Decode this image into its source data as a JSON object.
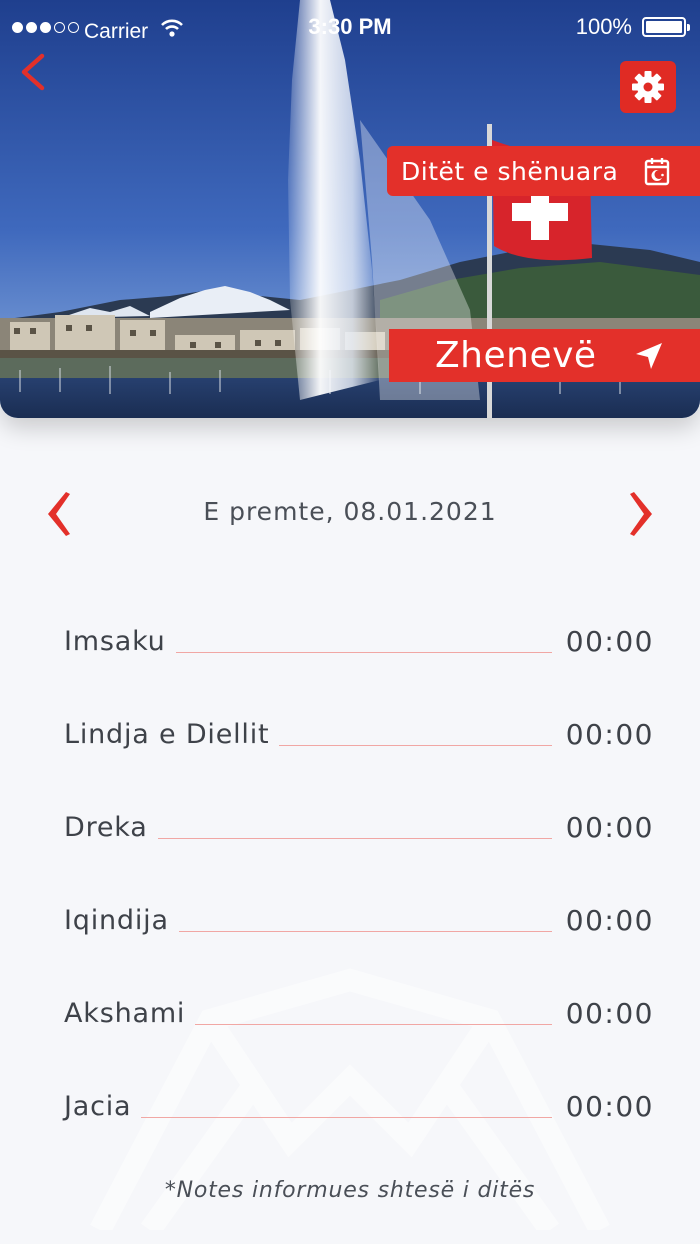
{
  "status_bar": {
    "carrier": "Carrier",
    "time": "3:30 PM",
    "battery": "100%"
  },
  "header": {
    "marked_days_label": "Ditët e shënuara",
    "city": "Zhenevë",
    "accent_color": "#e3302a"
  },
  "date": {
    "label": "E premte, 08.01.2021"
  },
  "prayers": [
    {
      "name": "Imsaku",
      "time": "00:00"
    },
    {
      "name": "Lindja e Diellit",
      "time": "00:00"
    },
    {
      "name": "Dreka",
      "time": "00:00"
    },
    {
      "name": "Iqindija",
      "time": "00:00"
    },
    {
      "name": "Akshami",
      "time": "00:00"
    },
    {
      "name": "Jacia",
      "time": "00:00"
    }
  ],
  "notes": "*Notes informues shtesë i ditës",
  "icons": {
    "back": "chevron-left-icon",
    "settings": "gear-icon",
    "calendar": "calendar-crescent-icon",
    "location": "location-arrow-icon",
    "prev": "chevron-left-icon",
    "next": "chevron-right-icon"
  }
}
